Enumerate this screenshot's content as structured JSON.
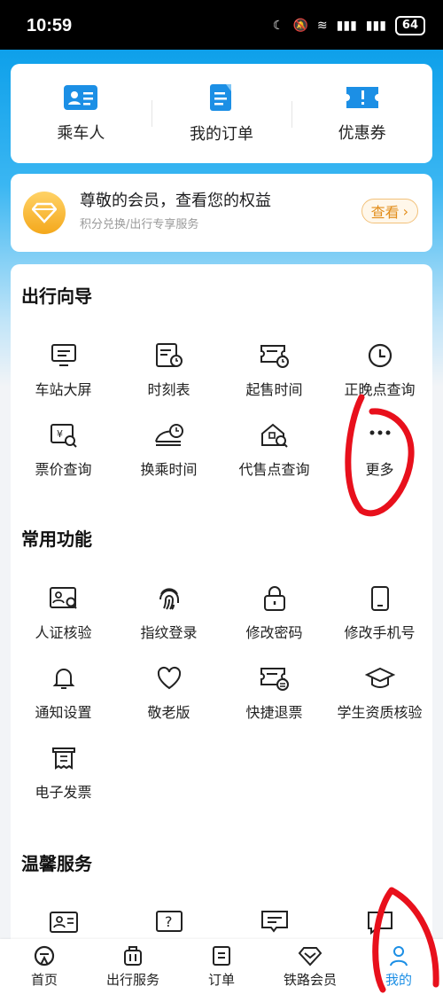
{
  "status": {
    "time": "10:59",
    "battery": "64"
  },
  "top": {
    "tiles": [
      {
        "label": "乘车人",
        "icon": "passenger-card-icon"
      },
      {
        "label": "我的订单",
        "icon": "order-document-icon"
      },
      {
        "label": "优惠券",
        "icon": "coupon-icon"
      }
    ]
  },
  "member": {
    "title": "尊敬的会员，查看您的权益",
    "subtitle": "积分兑换/出行专享服务",
    "button": "查看"
  },
  "guide": {
    "title": "出行向导",
    "items": [
      {
        "label": "车站大屏",
        "icon": "screen-icon"
      },
      {
        "label": "时刻表",
        "icon": "timetable-icon"
      },
      {
        "label": "起售时间",
        "icon": "ticket-clock-icon"
      },
      {
        "label": "正晚点查询",
        "icon": "clock-icon"
      },
      {
        "label": "票价查询",
        "icon": "price-search-icon"
      },
      {
        "label": "换乘时间",
        "icon": "train-clock-icon"
      },
      {
        "label": "代售点查询",
        "icon": "agency-search-icon"
      },
      {
        "label": "更多",
        "icon": "more-dots-icon"
      }
    ]
  },
  "common": {
    "title": "常用功能",
    "items": [
      {
        "label": "人证核验",
        "icon": "id-verify-icon"
      },
      {
        "label": "指纹登录",
        "icon": "fingerprint-icon"
      },
      {
        "label": "修改密码",
        "icon": "lock-icon"
      },
      {
        "label": "修改手机号",
        "icon": "phone-icon"
      },
      {
        "label": "通知设置",
        "icon": "bell-icon"
      },
      {
        "label": "敬老版",
        "icon": "heart-icon"
      },
      {
        "label": "快捷退票",
        "icon": "refund-ticket-icon"
      },
      {
        "label": "学生资质核验",
        "icon": "graduation-cap-icon"
      },
      {
        "label": "电子发票",
        "icon": "invoice-icon"
      }
    ]
  },
  "warm": {
    "title": "温馨服务"
  },
  "nav": [
    {
      "label": "首页",
      "icon": "home-railway-icon"
    },
    {
      "label": "出行服务",
      "icon": "luggage-icon"
    },
    {
      "label": "订单",
      "icon": "order-icon"
    },
    {
      "label": "铁路会员",
      "icon": "diamond-icon"
    },
    {
      "label": "我的",
      "icon": "person-icon"
    }
  ],
  "colors": {
    "accent": "#1c8fe5",
    "gold": "#f4a81c",
    "annotation": "#e8101c"
  }
}
